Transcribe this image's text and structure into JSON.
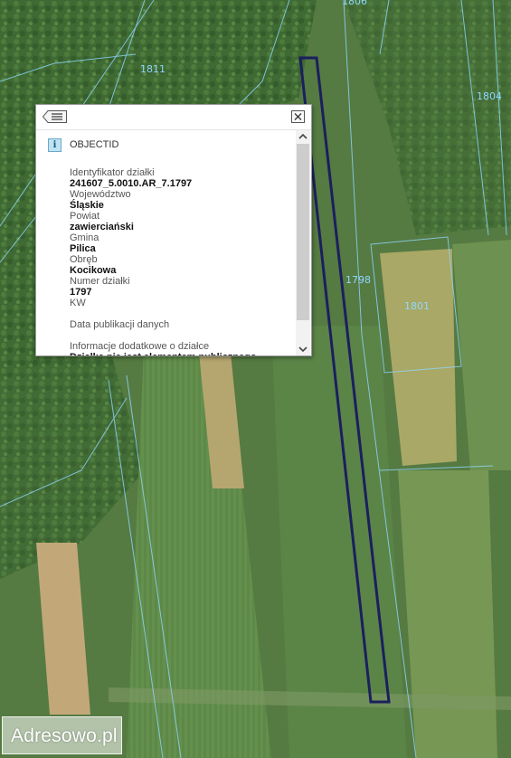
{
  "map": {
    "parcel_labels": [
      {
        "id": "1811",
        "text": "1811"
      },
      {
        "id": "1806",
        "text": "1806"
      },
      {
        "id": "1804",
        "text": "1804"
      },
      {
        "id": "1798",
        "text": "1798"
      },
      {
        "id": "1801",
        "text": "1801"
      }
    ],
    "highlight_color": "#1b1f5e",
    "boundary_color": "#8fd8ff"
  },
  "popup": {
    "title": "OBJECTID",
    "fields": [
      {
        "label": "Identyfikator działki",
        "value": "241607_5.0010.AR_7.1797"
      },
      {
        "label": "Województwo",
        "value": "Śląskie"
      },
      {
        "label": "Powiat",
        "value": "zawierciański"
      },
      {
        "label": "Gmina",
        "value": "Pilica"
      },
      {
        "label": "Obręb",
        "value": "Kocikowa"
      },
      {
        "label": "Numer działki",
        "value": "1797"
      },
      {
        "label": "KW",
        "value": ""
      },
      {
        "label": "Data publikacji danych",
        "value": ""
      },
      {
        "label": "Informacje dodatkowe o działce",
        "value": "Działka nie jest elementem publicznego rejestru jakim jest ewidencja gruntów i budynków"
      }
    ]
  },
  "watermark": {
    "text": "Adresowo.pl"
  }
}
